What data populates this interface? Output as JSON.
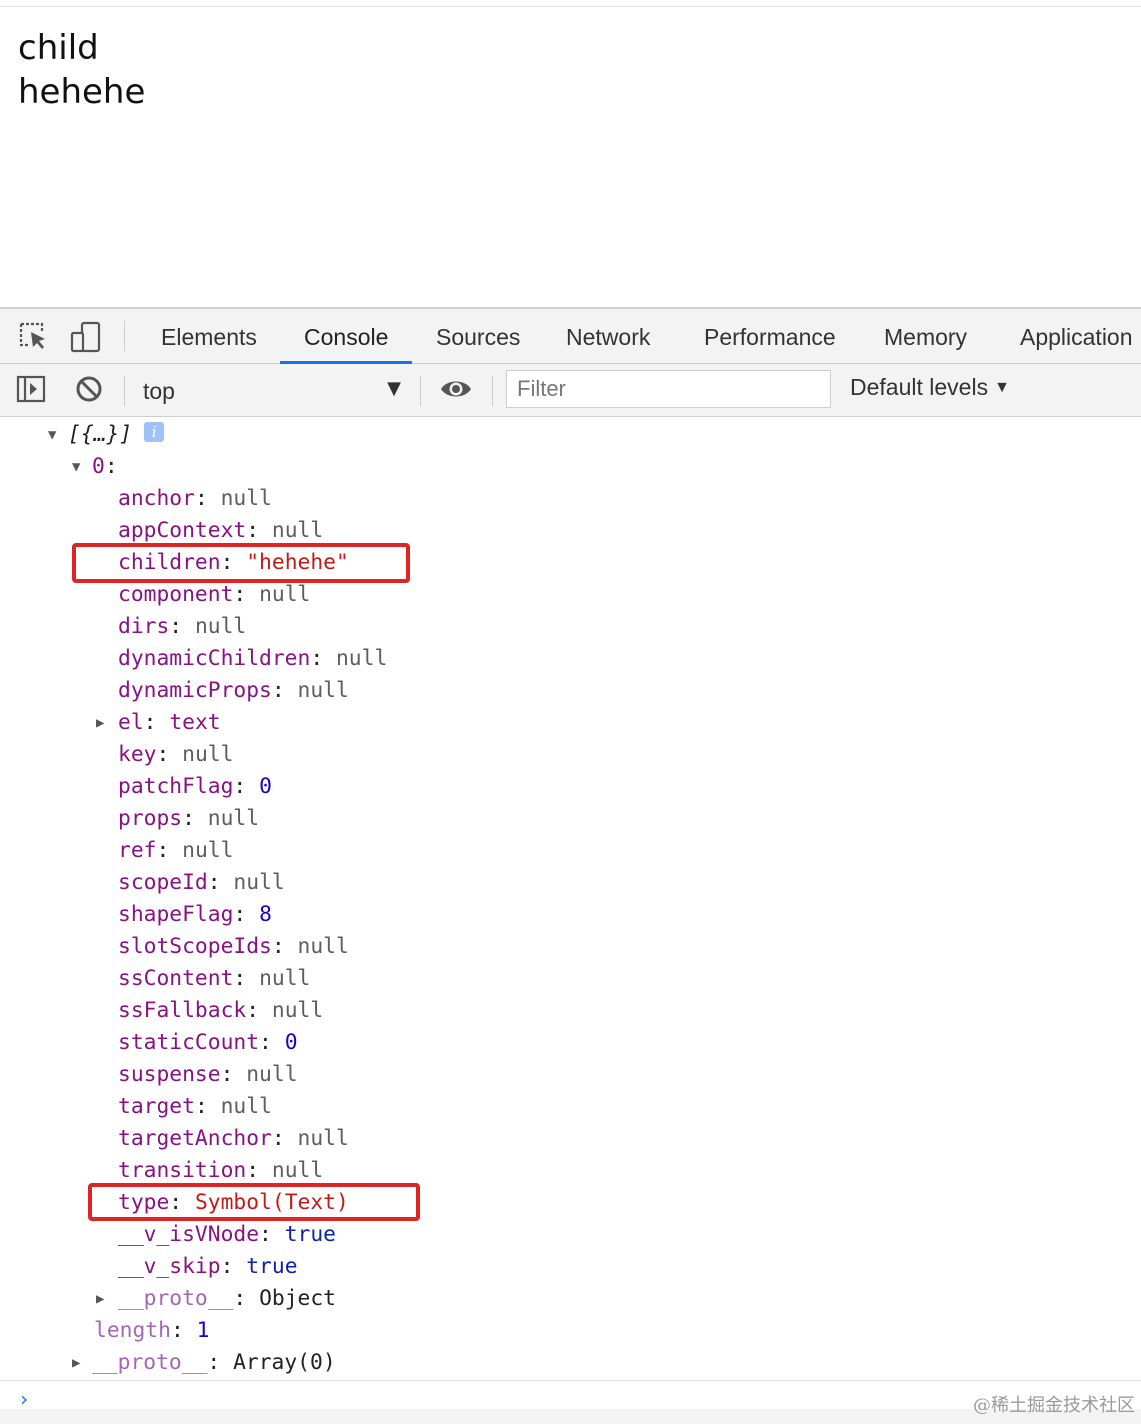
{
  "page": {
    "lines": [
      "child",
      "hehehe"
    ]
  },
  "devtools": {
    "icons": [
      "inspect-element-icon",
      "device-toolbar-icon"
    ],
    "tabs": [
      {
        "label": "Elements",
        "active": false
      },
      {
        "label": "Console",
        "active": true
      },
      {
        "label": "Sources",
        "active": false
      },
      {
        "label": "Network",
        "active": false
      },
      {
        "label": "Performance",
        "active": false
      },
      {
        "label": "Memory",
        "active": false
      },
      {
        "label": "Application",
        "active": false
      }
    ],
    "active_tab_color": "#1a73e8",
    "toolbar": {
      "context": "top",
      "filter_placeholder": "Filter",
      "levels": "Default levels"
    }
  },
  "console": {
    "array_summary": "[{…}]",
    "item_index": "0",
    "properties": [
      {
        "key": "anchor",
        "value": "null",
        "kind": "null"
      },
      {
        "key": "appContext",
        "value": "null",
        "kind": "null"
      },
      {
        "key": "children",
        "value": "\"hehehe\"",
        "kind": "str",
        "highlight": true
      },
      {
        "key": "component",
        "value": "null",
        "kind": "null"
      },
      {
        "key": "dirs",
        "value": "null",
        "kind": "null"
      },
      {
        "key": "dynamicChildren",
        "value": "null",
        "kind": "null"
      },
      {
        "key": "dynamicProps",
        "value": "null",
        "kind": "null"
      },
      {
        "key": "el",
        "value": "text",
        "kind": "node",
        "expandable": true
      },
      {
        "key": "key",
        "value": "null",
        "kind": "null"
      },
      {
        "key": "patchFlag",
        "value": "0",
        "kind": "num"
      },
      {
        "key": "props",
        "value": "null",
        "kind": "null"
      },
      {
        "key": "ref",
        "value": "null",
        "kind": "null"
      },
      {
        "key": "scopeId",
        "value": "null",
        "kind": "null"
      },
      {
        "key": "shapeFlag",
        "value": "8",
        "kind": "num"
      },
      {
        "key": "slotScopeIds",
        "value": "null",
        "kind": "null"
      },
      {
        "key": "ssContent",
        "value": "null",
        "kind": "null"
      },
      {
        "key": "ssFallback",
        "value": "null",
        "kind": "null"
      },
      {
        "key": "staticCount",
        "value": "0",
        "kind": "num"
      },
      {
        "key": "suspense",
        "value": "null",
        "kind": "null"
      },
      {
        "key": "target",
        "value": "null",
        "kind": "null"
      },
      {
        "key": "targetAnchor",
        "value": "null",
        "kind": "null"
      },
      {
        "key": "transition",
        "value": "null",
        "kind": "null"
      },
      {
        "key": "type",
        "value": "Symbol(Text)",
        "kind": "sym",
        "highlight": true
      },
      {
        "key": "__v_isVNode",
        "value": "true",
        "kind": "bool"
      },
      {
        "key": "__v_skip",
        "value": "true",
        "kind": "bool"
      },
      {
        "key": "__proto__",
        "value": "Object",
        "kind": "obj",
        "expandable": true,
        "dim": true
      }
    ],
    "array_length": {
      "key": "length",
      "value": "1"
    },
    "array_proto": {
      "key": "__proto__",
      "value": "Array(0)"
    },
    "highlight_color": "#e02424"
  },
  "watermark": "@稀土掘金技术社区"
}
